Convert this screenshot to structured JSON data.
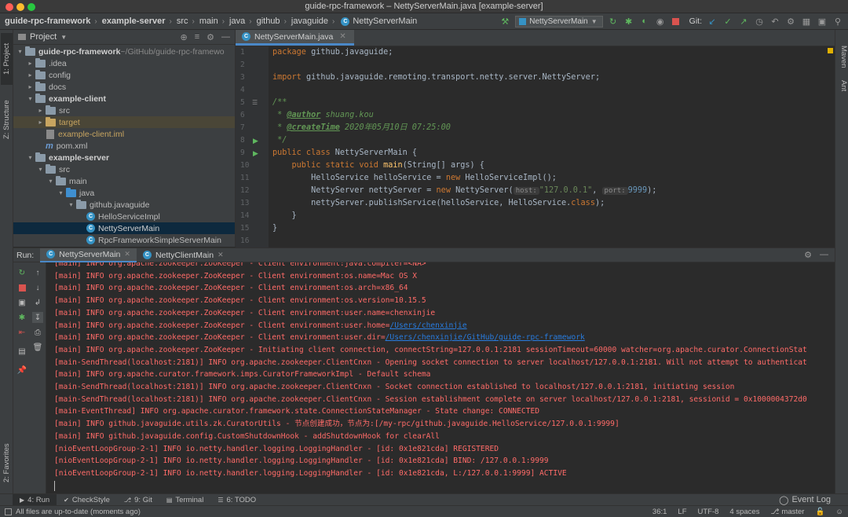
{
  "window": {
    "title": "guide-rpc-framework – NettyServerMain.java [example-server]"
  },
  "breadcrumb": [
    {
      "label": "guide-rpc-framework",
      "bold": true
    },
    {
      "label": "example-server",
      "bold": true
    },
    {
      "label": "src",
      "bold": false
    },
    {
      "label": "main",
      "bold": false
    },
    {
      "label": "java",
      "bold": false
    },
    {
      "label": "github",
      "bold": false
    },
    {
      "label": "javaguide",
      "bold": false
    },
    {
      "label": "NettyServerMain",
      "bold": false
    }
  ],
  "toolbar": {
    "run_config": "NettyServerMain",
    "git_label": "Git:"
  },
  "left_stripe": {
    "project": "1: Project",
    "structure": "Z: Structure",
    "favorites": "2: Favorites"
  },
  "right_stripe": {
    "maven": "Maven",
    "ant": "Ant"
  },
  "project": {
    "header": "Project",
    "root_path": "~/GitHub/guide-rpc-framewo",
    "tree": [
      {
        "label": "guide-rpc-framework",
        "indent": 0,
        "arrow": "▾",
        "icon": "folder",
        "color": "#d0d0d0",
        "bold": true
      },
      {
        "label": ".idea",
        "indent": 1,
        "arrow": "▸",
        "icon": "folder",
        "color": "#bbbbbb",
        "bold": false
      },
      {
        "label": "config",
        "indent": 1,
        "arrow": "▸",
        "icon": "folder",
        "color": "#bbbbbb",
        "bold": false
      },
      {
        "label": "docs",
        "indent": 1,
        "arrow": "▸",
        "icon": "folder",
        "color": "#bbbbbb",
        "bold": false
      },
      {
        "label": "example-client",
        "indent": 1,
        "arrow": "▾",
        "icon": "module",
        "color": "#d0d0d0",
        "bold": true
      },
      {
        "label": "src",
        "indent": 2,
        "arrow": "▸",
        "icon": "folder",
        "color": "#bbbbbb",
        "bold": false
      },
      {
        "label": "target",
        "indent": 2,
        "arrow": "▸",
        "icon": "target",
        "color": "#c8a560",
        "bold": false
      },
      {
        "label": "example-client.iml",
        "indent": 2,
        "arrow": "",
        "icon": "file",
        "color": "#c8a560",
        "bold": false
      },
      {
        "label": "pom.xml",
        "indent": 2,
        "arrow": "",
        "icon": "maven",
        "color": "#bbbbbb",
        "bold": false
      },
      {
        "label": "example-server",
        "indent": 1,
        "arrow": "▾",
        "icon": "module",
        "color": "#d0d0d0",
        "bold": true
      },
      {
        "label": "src",
        "indent": 2,
        "arrow": "▾",
        "icon": "folder",
        "color": "#bbbbbb",
        "bold": false
      },
      {
        "label": "main",
        "indent": 3,
        "arrow": "▾",
        "icon": "folder",
        "color": "#bbbbbb",
        "bold": false
      },
      {
        "label": "java",
        "indent": 4,
        "arrow": "▾",
        "icon": "srcfolder",
        "color": "#bbbbbb",
        "bold": false
      },
      {
        "label": "github.javaguide",
        "indent": 5,
        "arrow": "▾",
        "icon": "package",
        "color": "#bbbbbb",
        "bold": false
      },
      {
        "label": "HelloServiceImpl",
        "indent": 6,
        "arrow": "",
        "icon": "class",
        "color": "#bbbbbb",
        "bold": false
      },
      {
        "label": "NettyServerMain",
        "indent": 6,
        "arrow": "",
        "icon": "class",
        "color": "#d0d0d0",
        "bold": false,
        "selected": true
      },
      {
        "label": "RpcFrameworkSimpleServerMain",
        "indent": 6,
        "arrow": "",
        "icon": "class",
        "color": "#bbbbbb",
        "bold": false
      }
    ]
  },
  "editor": {
    "tab": "NettyServerMain.java",
    "line_numbers": [
      "1",
      "2",
      "3",
      "4",
      "5",
      "6",
      "7",
      "8",
      "9",
      "10",
      "11",
      "12",
      "13",
      "14",
      "15",
      "16"
    ],
    "code": {
      "pkg_kw": "package",
      "pkg_name": " github.javaguide;",
      "imp_kw": "import",
      "imp_name": " github.javaguide.remoting.transport.netty.server.NettyServer;",
      "doc_open": "/**",
      "doc_star1": " * ",
      "author_tag": "@author",
      "author_val": " shuang.kou",
      "doc_star2": " * ",
      "created_tag": "@createTime",
      "created_val": " 2020年05月10日 07:25:00",
      "doc_close": " */",
      "l8_kw": "public class",
      "l8_rest": " NettyServerMain {",
      "l9_kw": "    public static void",
      "l9_fn": " main",
      "l9_rest": "(String[] args) {",
      "l10_a": "        HelloService helloService = ",
      "l10_kw": "new",
      "l10_b": " HelloServiceImpl();",
      "l11_a": "        NettyServer nettyServer = ",
      "l11_kw": "new",
      "l11_b": " NettyServer(",
      "l11_hint1": "host:",
      "l11_str": "\"127.0.0.1\"",
      "l11_c": ",",
      "l11_hint2": "port:",
      "l11_num": "9999",
      "l11_d": ");",
      "l12_a": "        nettyServer.publishService(helloService, HelloService.",
      "l12_kw": "class",
      "l12_b": ");",
      "l13": "    }",
      "l14": "}"
    }
  },
  "run": {
    "label": "Run:",
    "tabs": [
      "NettyServerMain",
      "NettyClientMain"
    ],
    "console": [
      "[main] INFO org.apache.zookeeper.ZooKeeper - Client environment:java.compiler=<NA>",
      "[main] INFO org.apache.zookeeper.ZooKeeper - Client environment:os.name=Mac OS X",
      "[main] INFO org.apache.zookeeper.ZooKeeper - Client environment:os.arch=x86_64",
      "[main] INFO org.apache.zookeeper.ZooKeeper - Client environment:os.version=10.15.5",
      "[main] INFO org.apache.zookeeper.ZooKeeper - Client environment:user.name=chenxinjie",
      "[main] INFO org.apache.zookeeper.ZooKeeper - Client environment:user.home=",
      "[main] INFO org.apache.zookeeper.ZooKeeper - Client environment:user.dir=",
      "[main] INFO org.apache.zookeeper.ZooKeeper - Initiating client connection, connectString=127.0.0.1:2181 sessionTimeout=60000 watcher=org.apache.curator.ConnectionStat",
      "[main-SendThread(localhost:2181)] INFO org.apache.zookeeper.ClientCnxn - Opening socket connection to server localhost/127.0.0.1:2181. Will not attempt to authenticat",
      "[main] INFO org.apache.curator.framework.imps.CuratorFrameworkImpl - Default schema",
      "[main-SendThread(localhost:2181)] INFO org.apache.zookeeper.ClientCnxn - Socket connection established to localhost/127.0.0.1:2181, initiating session",
      "[main-SendThread(localhost:2181)] INFO org.apache.zookeeper.ClientCnxn - Session establishment complete on server localhost/127.0.0.1:2181, sessionid = 0x1000004372d0",
      "[main-EventThread] INFO org.apache.curator.framework.state.ConnectionStateManager - State change: CONNECTED",
      "[main] INFO github.javaguide.utils.zk.CuratorUtils - 节点创建成功，节点为:[/my-rpc/github.javaguide.HelloService/127.0.0.1:9999]",
      "[main] INFO github.javaguide.config.CustomShutdownHook - addShutdownHook for clearAll",
      "[nioEventLoopGroup-2-1] INFO io.netty.handler.logging.LoggingHandler - [id: 0x1e821cda] REGISTERED",
      "[nioEventLoopGroup-2-1] INFO io.netty.handler.logging.LoggingHandler - [id: 0x1e821cda] BIND: /127.0.0.1:9999",
      "[nioEventLoopGroup-2-1] INFO io.netty.handler.logging.LoggingHandler - [id: 0x1e821cda, L:/127.0.0.1:9999] ACTIVE"
    ],
    "links": {
      "user_home": "/Users/chenxinjie",
      "user_dir": "/Users/chenxinjie/GitHub/guide-rpc-framework"
    }
  },
  "bottom_tabs": [
    {
      "label": "4: Run",
      "icon": "▶",
      "active": true
    },
    {
      "label": "CheckStyle",
      "icon": "✔",
      "active": false
    },
    {
      "label": "9: Git",
      "icon": "⎇",
      "active": false
    },
    {
      "label": "Terminal",
      "icon": "▤",
      "active": false
    },
    {
      "label": "6: TODO",
      "icon": "☰",
      "active": false
    }
  ],
  "event_log": "Event Log",
  "status": {
    "message": "All files are up-to-date (moments ago)",
    "position": "36:1",
    "line_sep": "LF",
    "encoding": "UTF-8",
    "indent": "4 spaces",
    "branch": "master"
  },
  "colors": {
    "accent": "#4a88c7",
    "error_text": "#ff6b68",
    "link": "#287bde",
    "selection": "#0d293e"
  }
}
